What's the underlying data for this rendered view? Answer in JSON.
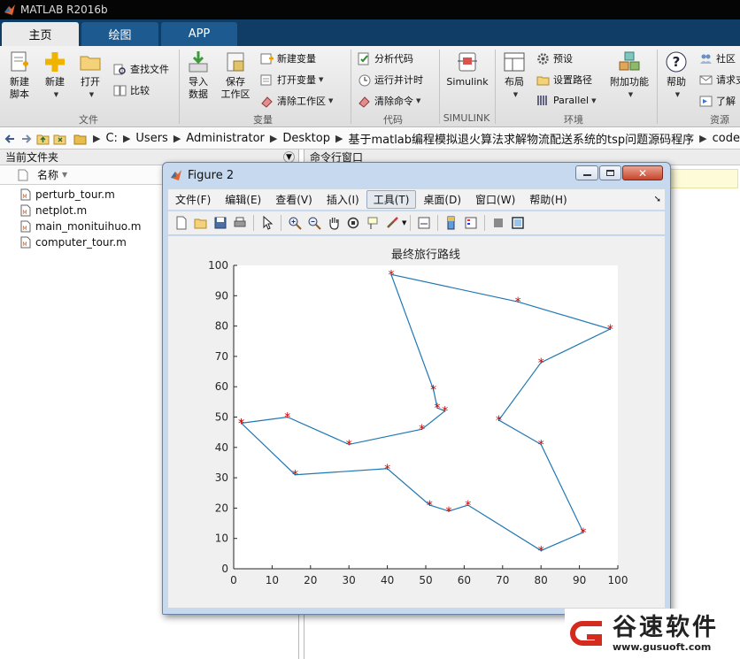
{
  "window": {
    "title": "MATLAB R2016b"
  },
  "tabs": [
    {
      "label": "主页",
      "active": true
    },
    {
      "label": "绘图",
      "active": false
    },
    {
      "label": "APP",
      "active": false
    }
  ],
  "ribbon": {
    "file": {
      "new_script": "新建\n脚本",
      "new": "新建",
      "open": "打开",
      "find_files": "查找文件",
      "compare": "比较",
      "label": "文件"
    },
    "variable": {
      "import_data": "导入\n数据",
      "save_workspace": "保存\n工作区",
      "new_variable": "新建变量",
      "open_variable": "打开变量",
      "clear_workspace": "清除工作区",
      "label": "变量"
    },
    "code": {
      "analyze_code": "分析代码",
      "run_and_time": "运行并计时",
      "clear_commands": "清除命令",
      "label": "代码"
    },
    "simulink": {
      "button": "Simulink",
      "label": "SIMULINK"
    },
    "environment": {
      "layout": "布局",
      "preferences": "预设",
      "set_path": "设置路径",
      "parallel": "Parallel",
      "addons": "附加功能",
      "label": "环境"
    },
    "resources": {
      "help": "帮助",
      "community": "社区",
      "request_support": "请求支",
      "learn": "了解",
      "label": "资源"
    }
  },
  "address": {
    "crumbs": [
      "C:",
      "Users",
      "Administrator",
      "Desktop",
      "基于matlab编程模拟退火算法求解物流配送系统的tsp问题源码程序",
      "code"
    ]
  },
  "current_folder": {
    "title": "当前文件夹",
    "column": "名称",
    "files": [
      "perturb_tour.m",
      "netplot.m",
      "main_monituihuo.m",
      "computer_tour.m"
    ]
  },
  "command_window": {
    "title": "命令行窗口"
  },
  "figure": {
    "title": "Figure 2",
    "menus": [
      "文件(F)",
      "编辑(E)",
      "查看(V)",
      "插入(I)",
      "工具(T)",
      "桌面(D)",
      "窗口(W)",
      "帮助(H)"
    ],
    "highlighted_menu": "工具(T)"
  },
  "chart_data": {
    "type": "line",
    "title": "最终旅行路线",
    "xlabel": "",
    "ylabel": "",
    "xlim": [
      0,
      100
    ],
    "ylim": [
      0,
      100
    ],
    "xticks": [
      0,
      10,
      20,
      30,
      40,
      50,
      60,
      70,
      80,
      90,
      100
    ],
    "yticks": [
      0,
      10,
      20,
      30,
      40,
      50,
      60,
      70,
      80,
      90,
      100
    ],
    "grid": false,
    "series": [
      {
        "line_color": "#1f77b4",
        "marker": "*",
        "marker_color": "#cc0000",
        "x": [
          2,
          14,
          30,
          49,
          55,
          53,
          52,
          41,
          74,
          98,
          80,
          69,
          80,
          91,
          80,
          61,
          56,
          51,
          40,
          16,
          2
        ],
        "y": [
          48,
          50,
          41,
          46,
          52,
          53,
          59,
          97,
          88,
          79,
          68,
          49,
          41,
          12,
          6,
          21,
          19,
          21,
          33,
          31,
          48
        ]
      }
    ]
  },
  "watermark": {
    "brand": "谷速软件",
    "url": "www.gusuoft.com",
    "color": "#d42b1e"
  }
}
